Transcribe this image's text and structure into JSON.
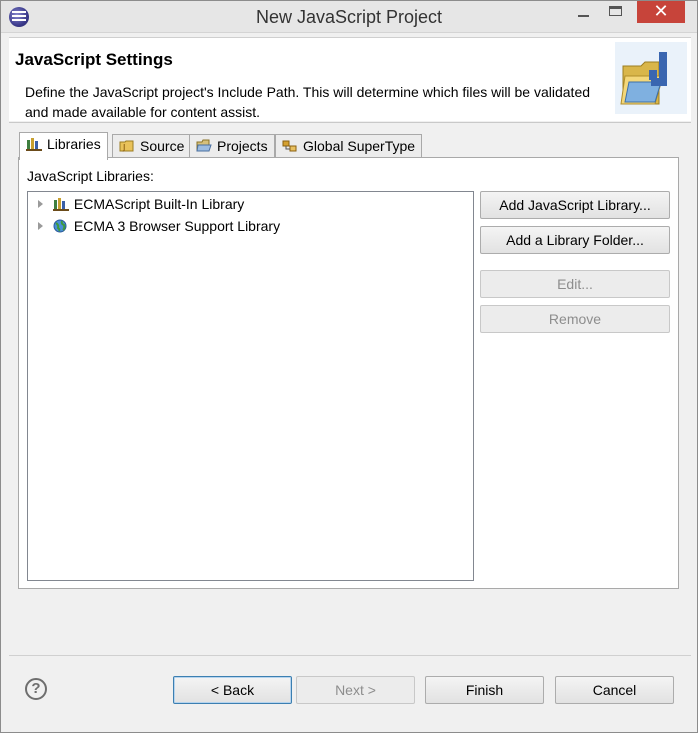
{
  "window": {
    "title": "New JavaScript Project"
  },
  "header": {
    "title": "JavaScript Settings",
    "description": "Define the JavaScript project's Include Path. This will determine which files will be validated and made available for content assist."
  },
  "tabs": [
    {
      "label": "Libraries",
      "icon": "library-icon",
      "active": true
    },
    {
      "label": "Source",
      "icon": "source-icon",
      "active": false
    },
    {
      "label": "Projects",
      "icon": "projects-icon",
      "active": false
    },
    {
      "label": "Global SuperType",
      "icon": "supertype-icon",
      "active": false
    }
  ],
  "libraries": {
    "label": "JavaScript Libraries:",
    "items": [
      {
        "label": "ECMAScript Built-In Library",
        "icon": "library-icon"
      },
      {
        "label": "ECMA 3 Browser Support Library",
        "icon": "globe-icon"
      }
    ]
  },
  "side_buttons": {
    "add_library": "Add JavaScript Library...",
    "add_folder": "Add a Library Folder...",
    "edit": "Edit...",
    "remove": "Remove"
  },
  "footer": {
    "help_icon": "?",
    "back": "< Back",
    "next": "Next >",
    "finish": "Finish",
    "cancel": "Cancel"
  },
  "colors": {
    "close_button": "#c7443a",
    "focus_border": "#3c7fb1",
    "disabled_text": "#8d8d8d"
  }
}
